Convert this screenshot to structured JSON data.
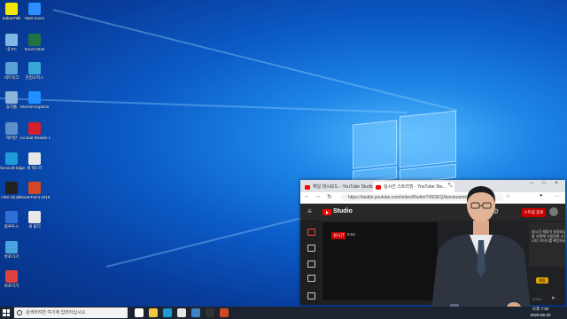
{
  "desktop": {
    "icons": [
      {
        "name": "kakaotalk-icon",
        "label": "KakaoTalk",
        "color": "#f7e600"
      },
      {
        "name": "zoom-icon",
        "label": "Start Zoom",
        "color": "#2d8cff"
      },
      {
        "name": "computer-icon",
        "label": "내 PC",
        "color": "#7fb8e6"
      },
      {
        "name": "excel-icon",
        "label": "Excel 2016",
        "color": "#1f7244"
      },
      {
        "name": "network-icon",
        "label": "네트워크",
        "color": "#5aa0d6"
      },
      {
        "name": "hancom-icon",
        "label": "한컴오피스",
        "color": "#3aa6d8"
      },
      {
        "name": "recycle-bin-icon",
        "label": "휴지통",
        "color": "#8ab4d8"
      },
      {
        "name": "internet-explorer-icon",
        "label": "Internet Explorer",
        "color": "#1e90ff"
      },
      {
        "name": "control-panel-icon",
        "label": "제어판",
        "color": "#5b8fc7"
      },
      {
        "name": "acrobat-icon",
        "label": "Acrobat Reader DC",
        "color": "#d4202a"
      },
      {
        "name": "edge-icon",
        "label": "Microsoft Edge",
        "color": "#1e9ad6"
      },
      {
        "name": "document-icon",
        "label": "새 텍스트",
        "color": "#e8e8e8"
      },
      {
        "name": "obs-icon",
        "label": "OBS Studio",
        "color": "#222222"
      },
      {
        "name": "powerpoint-icon",
        "label": "PowerPoint 2016",
        "color": "#d24726"
      },
      {
        "name": "bluetooth-icon",
        "label": "블루투스",
        "color": "#2f6fd6"
      },
      {
        "name": "folder-icon",
        "label": "새 폴더",
        "color": "#e8e8e8"
      },
      {
        "name": "app-icon-1",
        "label": "바로가기",
        "color": "#4aa3df"
      },
      {
        "name": "app-icon-2",
        "label": "바로가기",
        "color": "#e04040"
      }
    ]
  },
  "browser": {
    "tabs": [
      {
        "label": "채널 대시보드 - YouTube Studio",
        "active": false
      },
      {
        "label": "실시간 스트리밍 - YouTube Stu...",
        "active": true
      }
    ],
    "url": "https://studio.youtube.com/video/l5wbmT00GKQ/livestreaming",
    "studio_name": "Studio",
    "end_stream_label": "스트림 종료",
    "live_badge": "실시간",
    "timecode": "0:04",
    "chat_lines": [
      "실시간 채팅이 설정되었습니다. 채팅",
      "을 사용해 시청자와 소통하세요. 커뮤",
      "니티 가이드를 확인하세요."
    ],
    "chat_count": "0/200",
    "emoji_label": "채팅"
  },
  "taskbar": {
    "search_placeholder": "검색하려면 여기에 입력하십시오.",
    "apps": [
      {
        "name": "task-view-icon",
        "color": "#ffffff"
      },
      {
        "name": "explorer-icon",
        "color": "#f4c542"
      },
      {
        "name": "edge-taskbar-icon",
        "color": "#1e9ad6"
      },
      {
        "name": "store-icon",
        "color": "#e6e6e6"
      },
      {
        "name": "mail-icon",
        "color": "#3b82c6"
      },
      {
        "name": "obs-taskbar-icon",
        "color": "#333333"
      },
      {
        "name": "powerpoint-taskbar-icon",
        "color": "#d24726"
      }
    ],
    "time": "오후 7:30",
    "date": "2020-06-20"
  }
}
